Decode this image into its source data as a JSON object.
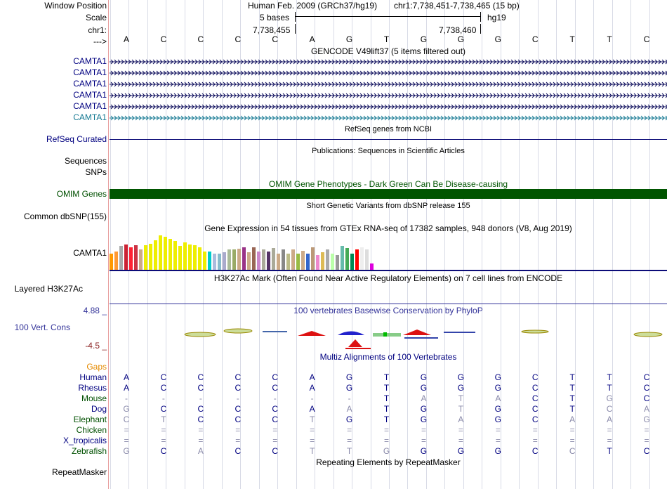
{
  "labels": {
    "window_position": "Window Position",
    "scale": "Scale",
    "chrom": "chr1:",
    "arrow": "--->",
    "gencode_genes": [
      "CAMTA1",
      "CAMTA1",
      "CAMTA1",
      "CAMTA1",
      "CAMTA1",
      "CAMTA1"
    ],
    "refseq": "RefSeq Curated",
    "sequences": "Sequences",
    "snps": "SNPs",
    "omim": "OMIM Genes",
    "dbsnp": "Common dbSNP(155)",
    "gtex": "CAMTA1",
    "h3k27ac": "Layered H3K27Ac",
    "cons_max": "4.88 _",
    "cons": "100 Vert. Cons",
    "cons_min": "-4.5 _",
    "gaps": "Gaps",
    "species": [
      "Human",
      "Rhesus",
      "Mouse",
      "Dog",
      "Elephant",
      "Chicken",
      "X_tropicalis",
      "Zebrafish"
    ],
    "repeatmasker": "RepeatMasker"
  },
  "header": {
    "assembly": "Human Feb. 2009 (GRCh37/hg19)",
    "position": "chr1:7,738,451-7,738,465 (15 bp)",
    "scale_text": "5 bases",
    "db": "hg19",
    "pos_left": "7,738,455",
    "pos_right": "7,738,460"
  },
  "bases": [
    "A",
    "C",
    "C",
    "C",
    "C",
    "A",
    "G",
    "T",
    "G",
    "G",
    "G",
    "C",
    "T",
    "T",
    "C"
  ],
  "tracks": {
    "gencode": "GENCODE V49lift37 (5 items filtered out)",
    "refseq": "RefSeq genes from NCBI",
    "publications": "Publications: Sequences in Scientific Articles",
    "omim": "OMIM Gene Phenotypes - Dark Green Can Be Disease-causing",
    "dbsnp": "Short Genetic Variants from dbSNP release 155",
    "gtex": "Gene Expression in 54 tissues from GTEx RNA-seq of 17382 samples, 948 donors (V8, Aug 2019)",
    "h3k27ac": "H3K27Ac Mark (Often Found Near Active Regulatory Elements) on 7 cell lines from ENCODE",
    "phylop": "100 vertebrates Basewise Conservation by PhyloP",
    "multiz": "Multiz Alignments of 100 Vertebrates",
    "repeats": "Repeating Elements by RepeatMasker"
  },
  "alignment": [
    [
      "A",
      "C",
      "C",
      "C",
      "C",
      "A",
      "G",
      "T",
      "G",
      "G",
      "G",
      "C",
      "T",
      "T",
      "C"
    ],
    [
      "A",
      "C",
      "C",
      "C",
      "C",
      "A",
      "G",
      "T",
      "G",
      "G",
      "G",
      "C",
      "T",
      "T",
      "C"
    ],
    [
      "-",
      "-",
      "-",
      "-",
      "-",
      "-",
      "-",
      "T",
      "A",
      "T",
      "A",
      "C",
      "T",
      "G",
      "C"
    ],
    [
      "G",
      "C",
      "C",
      "C",
      "C",
      "A",
      "A",
      "T",
      "G",
      "T",
      "G",
      "C",
      "T",
      "C",
      "A"
    ],
    [
      "C",
      "T",
      "C",
      "C",
      "C",
      "T",
      "G",
      "T",
      "G",
      "A",
      "G",
      "C",
      "A",
      "A",
      "G"
    ],
    [
      "=",
      "=",
      "=",
      "=",
      "=",
      "=",
      "=",
      "=",
      "=",
      "=",
      "=",
      "=",
      "=",
      "=",
      "="
    ],
    [
      "=",
      "=",
      "=",
      "=",
      "=",
      "=",
      "=",
      "=",
      "=",
      "=",
      "=",
      "=",
      "=",
      "=",
      "="
    ],
    [
      "G",
      "C",
      "A",
      "C",
      "C",
      "T",
      "T",
      "G",
      "G",
      "G",
      "G",
      "C",
      "C",
      "T",
      "C"
    ]
  ],
  "gtex_values": [
    0.45,
    0.5,
    0.65,
    0.7,
    0.62,
    0.67,
    0.55,
    0.68,
    0.72,
    0.8,
    0.95,
    0.9,
    0.85,
    0.78,
    0.65,
    0.75,
    0.7,
    0.68,
    0.62,
    0.5,
    0.5,
    0.45,
    0.45,
    0.48,
    0.55,
    0.55,
    0.58,
    0.62,
    0.48,
    0.62,
    0.5,
    0.55,
    0.5,
    0.6,
    0.45,
    0.55,
    0.45,
    0.55,
    0.45,
    0.52,
    0.45,
    0.62,
    0.4,
    0.48,
    0.55,
    0.45,
    0.4,
    0.65,
    0.6,
    0.45,
    0.55,
    0.62,
    0.55,
    0.18
  ],
  "gtex_colors": [
    "#ff9900",
    "#ff9933",
    "#aaaaaa",
    "#cc2233",
    "#ff2233",
    "#cc3344",
    "#ccaa88",
    "#eeee00",
    "#eeee00",
    "#eeee00",
    "#eeee00",
    "#eeee00",
    "#eeee00",
    "#eeee00",
    "#eeee00",
    "#eeee00",
    "#eeee00",
    "#eeee00",
    "#eeee00",
    "#eeee00",
    "#00cccc",
    "#aabbdd",
    "#88bbcc",
    "#aaaacc",
    "#aabb99",
    "#99aa66",
    "#ccaa88",
    "#993388",
    "#ccaa88",
    "#996655",
    "#cc88cc",
    "#aaaa99",
    "#553366",
    "#aaaa99",
    "#ccaa88",
    "#888888",
    "#bbbb88",
    "#ccaa88",
    "#99bb44",
    "#ccaa88",
    "#3366cc",
    "#bb9977",
    "#ee88cc",
    "#ddbb55",
    "#aaaaaa",
    "#bbffaa",
    "#999999",
    "#66bbaa",
    "#44aa55",
    "#008855",
    "#ff0000",
    "#eeeeee",
    "#dddddd",
    "#dd00dd"
  ],
  "colors": {
    "gene_dark": "#0a0a5a",
    "gene_light": "#167a93",
    "omim_green": "#005500",
    "refseq_navy": "#0c0c78",
    "cons_blue": "#333399",
    "cons_red": "#8b2222",
    "gaps_orange": "#e58a00",
    "label_navy": "#000080",
    "label_green": "#005000"
  }
}
